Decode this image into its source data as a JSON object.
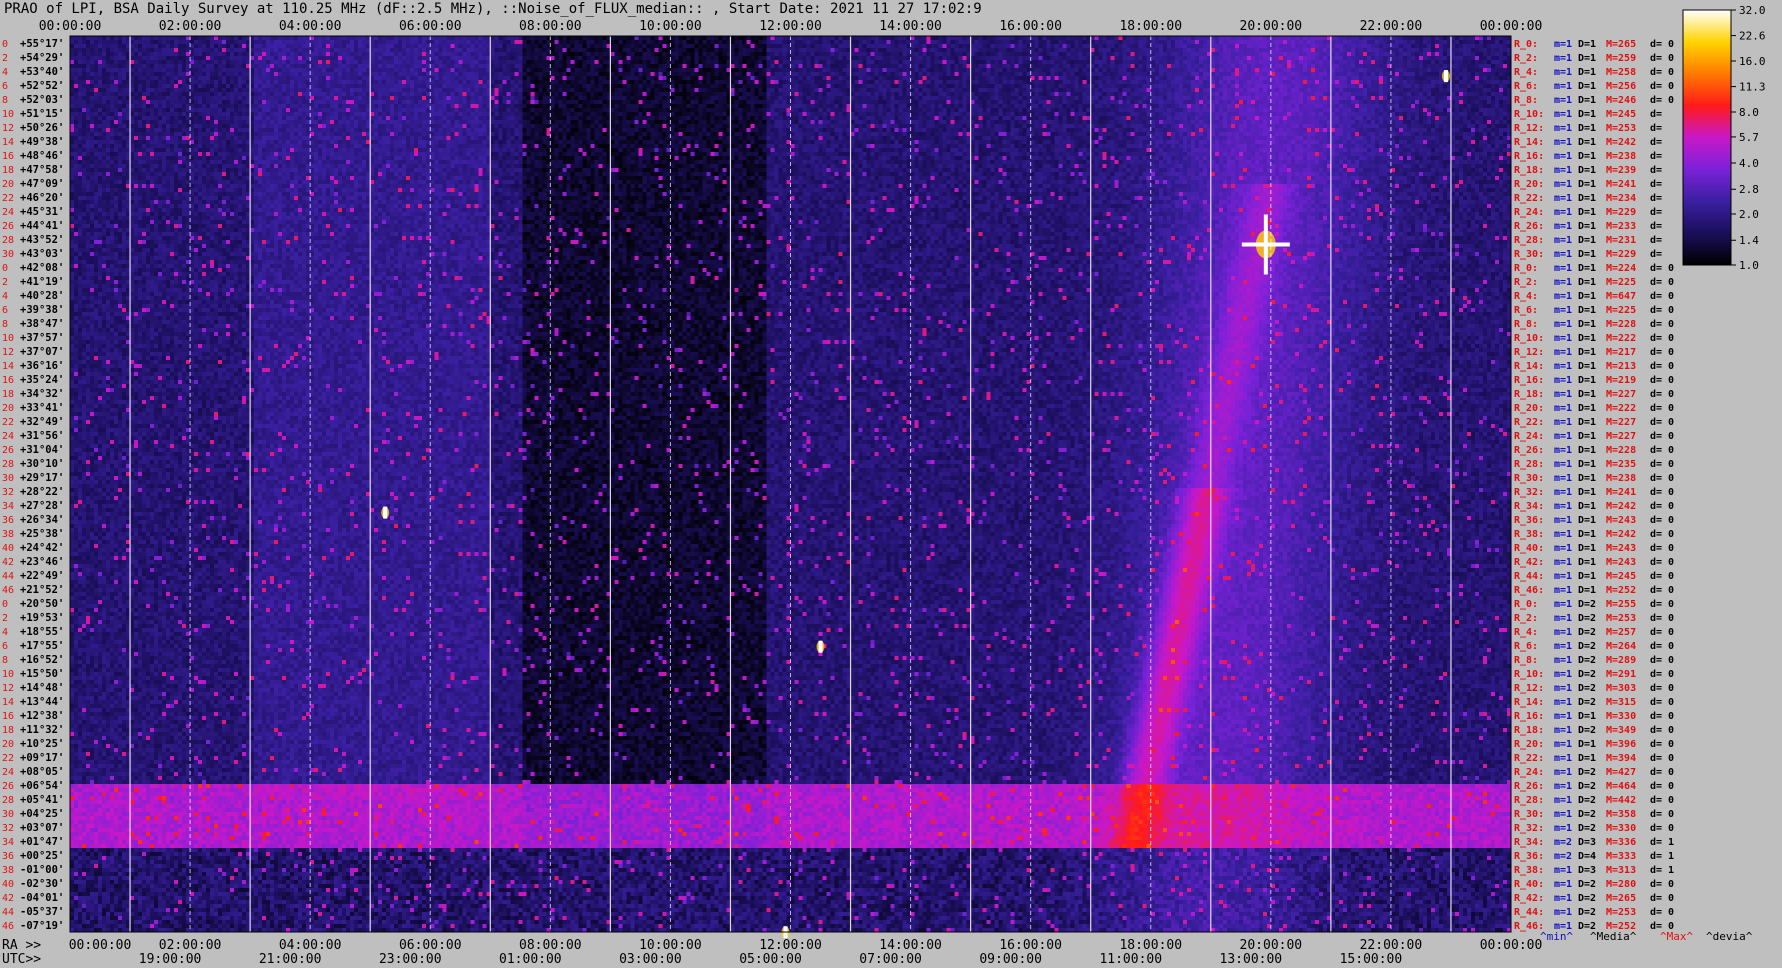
{
  "chart_data": {
    "type": "heatmap",
    "title": "PRAO of LPI, BSA Daily Survey at 110.25 MHz (dF::2.5 MHz), ::Noise_of_FLUX_median:: , Start Date: 2021 11 27 17:02:9",
    "x_top_ticks": [
      "00:00:00",
      "02:00:00",
      "04:00:00",
      "06:00:00",
      "08:00:00",
      "10:00:00",
      "12:00:00",
      "14:00:00",
      "16:00:00",
      "18:00:00",
      "20:00:00",
      "22:00:00",
      "00:00:00"
    ],
    "x_bottom_ra_ticks": [
      "00:00:00",
      "02:00:00",
      "04:00:00",
      "06:00:00",
      "08:00:00",
      "10:00:00",
      "12:00:00",
      "14:00:00",
      "16:00:00",
      "18:00:00",
      "20:00:00",
      "22:00:00",
      "00:00:00"
    ],
    "x_bottom_utc_ticks": [
      "19:00:00",
      "21:00:00",
      "23:00:00",
      "01:00:00",
      "03:00:00",
      "05:00:00",
      "07:00:00",
      "09:00:00",
      "11:00:00",
      "13:00:00",
      "15:00:00"
    ],
    "ra_label": "RA >>",
    "utc_label": "UTC>>",
    "y_ticks": [
      "+55°17'",
      "+54°29'",
      "+53°40'",
      "+52°52'",
      "+52°03'",
      "+51°15'",
      "+50°26'",
      "+49°38'",
      "+48°46'",
      "+47°58'",
      "+47°09'",
      "+46°20'",
      "+45°31'",
      "+44°41'",
      "+43°52'",
      "+43°03'",
      "+42°08'",
      "+41°19'",
      "+40°28'",
      "+39°38'",
      "+38°47'",
      "+37°57'",
      "+37°07'",
      "+36°16'",
      "+35°24'",
      "+34°32'",
      "+33°41'",
      "+32°49'",
      "+31°56'",
      "+31°04'",
      "+30°10'",
      "+29°17'",
      "+28°22'",
      "+27°28'",
      "+26°34'",
      "+25°38'",
      "+24°42'",
      "+23°46'",
      "+22°49'",
      "+21°52'",
      "+20°50'",
      "+19°53'",
      "+18°55'",
      "+17°55'",
      "+16°52'",
      "+15°50'",
      "+14°48'",
      "+13°44'",
      "+12°38'",
      "+11°32'",
      "+10°25'",
      "+09°17'",
      "+08°05'",
      "+06°54'",
      "+05°41'",
      "+04°25'",
      "+03°07'",
      "+01°47'",
      "+00°25'",
      "-01°00'",
      "-02°30'",
      "-04°01'",
      "-05°37'",
      "-07°19'"
    ],
    "row_index_labels": [
      "0",
      "2",
      "4",
      "6",
      "8",
      "10",
      "12",
      "14",
      "16",
      "18",
      "20",
      "22",
      "24",
      "26",
      "28",
      "30",
      "0",
      "2",
      "4",
      "6",
      "8",
      "10",
      "12",
      "14",
      "16",
      "18",
      "20",
      "22",
      "24",
      "26",
      "28",
      "30",
      "32",
      "34",
      "36",
      "38",
      "40",
      "42",
      "44",
      "46",
      "0",
      "2",
      "4",
      "6",
      "8",
      "10",
      "12",
      "14",
      "16",
      "18",
      "20",
      "22",
      "24",
      "26",
      "28",
      "30",
      "32",
      "34",
      "36",
      "38",
      "40",
      "42",
      "44",
      "46"
    ],
    "colorbar": {
      "ticks": [
        "32.0",
        "22.6",
        "16.0",
        "11.3",
        "8.0",
        "5.7",
        "4.0",
        "2.8",
        "2.0",
        "1.4",
        "1.0"
      ],
      "min": 1.0,
      "max": 32.0,
      "scale": "log",
      "colors": [
        "#000000",
        "#1a0f5a",
        "#3a1fa0",
        "#7a22d8",
        "#c818c8",
        "#ff1a1a",
        "#ff7a00",
        "#ffd400",
        "#ffffff"
      ]
    },
    "right_table": [
      {
        "r": "R_0:",
        "m": "m=1",
        "d": "D=1",
        "max": "M=265",
        "dev": "d= 0"
      },
      {
        "r": "R_2:",
        "m": "m=1",
        "d": "D=1",
        "max": "M=259",
        "dev": "d= 0"
      },
      {
        "r": "R_4:",
        "m": "m=1",
        "d": "D=1",
        "max": "M=258",
        "dev": "d= 0"
      },
      {
        "r": "R_6:",
        "m": "m=1",
        "d": "D=1",
        "max": "M=256",
        "dev": "d= 0"
      },
      {
        "r": "R_8:",
        "m": "m=1",
        "d": "D=1",
        "max": "M=246",
        "dev": "d= 0"
      },
      {
        "r": "R_10:",
        "m": "m=1",
        "d": "D=1",
        "max": "M=245",
        "dev": "d="
      },
      {
        "r": "R_12:",
        "m": "m=1",
        "d": "D=1",
        "max": "M=253",
        "dev": "d="
      },
      {
        "r": "R_14:",
        "m": "m=1",
        "d": "D=1",
        "max": "M=242",
        "dev": "d="
      },
      {
        "r": "R_16:",
        "m": "m=1",
        "d": "D=1",
        "max": "M=238",
        "dev": "d="
      },
      {
        "r": "R_18:",
        "m": "m=1",
        "d": "D=1",
        "max": "M=239",
        "dev": "d="
      },
      {
        "r": "R_20:",
        "m": "m=1",
        "d": "D=1",
        "max": "M=241",
        "dev": "d="
      },
      {
        "r": "R_22:",
        "m": "m=1",
        "d": "D=1",
        "max": "M=234",
        "dev": "d="
      },
      {
        "r": "R_24:",
        "m": "m=1",
        "d": "D=1",
        "max": "M=229",
        "dev": "d="
      },
      {
        "r": "R_26:",
        "m": "m=1",
        "d": "D=1",
        "max": "M=233",
        "dev": "d="
      },
      {
        "r": "R_28:",
        "m": "m=1",
        "d": "D=1",
        "max": "M=231",
        "dev": "d="
      },
      {
        "r": "R_30:",
        "m": "m=1",
        "d": "D=1",
        "max": "M=229",
        "dev": "d="
      },
      {
        "r": "R_0:",
        "m": "m=1",
        "d": "D=1",
        "max": "M=224",
        "dev": "d= 0"
      },
      {
        "r": "R_2:",
        "m": "m=1",
        "d": "D=1",
        "max": "M=225",
        "dev": "d= 0"
      },
      {
        "r": "R_4:",
        "m": "m=1",
        "d": "D=1",
        "max": "M=647",
        "dev": "d= 0"
      },
      {
        "r": "R_6:",
        "m": "m=1",
        "d": "D=1",
        "max": "M=225",
        "dev": "d= 0"
      },
      {
        "r": "R_8:",
        "m": "m=1",
        "d": "D=1",
        "max": "M=228",
        "dev": "d= 0"
      },
      {
        "r": "R_10:",
        "m": "m=1",
        "d": "D=1",
        "max": "M=222",
        "dev": "d= 0"
      },
      {
        "r": "R_12:",
        "m": "m=1",
        "d": "D=1",
        "max": "M=217",
        "dev": "d= 0"
      },
      {
        "r": "R_14:",
        "m": "m=1",
        "d": "D=1",
        "max": "M=213",
        "dev": "d= 0"
      },
      {
        "r": "R_16:",
        "m": "m=1",
        "d": "D=1",
        "max": "M=219",
        "dev": "d= 0"
      },
      {
        "r": "R_18:",
        "m": "m=1",
        "d": "D=1",
        "max": "M=227",
        "dev": "d= 0"
      },
      {
        "r": "R_20:",
        "m": "m=1",
        "d": "D=1",
        "max": "M=222",
        "dev": "d= 0"
      },
      {
        "r": "R_22:",
        "m": "m=1",
        "d": "D=1",
        "max": "M=227",
        "dev": "d= 0"
      },
      {
        "r": "R_24:",
        "m": "m=1",
        "d": "D=1",
        "max": "M=227",
        "dev": "d= 0"
      },
      {
        "r": "R_26:",
        "m": "m=1",
        "d": "D=1",
        "max": "M=228",
        "dev": "d= 0"
      },
      {
        "r": "R_28:",
        "m": "m=1",
        "d": "D=1",
        "max": "M=235",
        "dev": "d= 0"
      },
      {
        "r": "R_30:",
        "m": "m=1",
        "d": "D=1",
        "max": "M=238",
        "dev": "d= 0"
      },
      {
        "r": "R_32:",
        "m": "m=1",
        "d": "D=1",
        "max": "M=241",
        "dev": "d= 0"
      },
      {
        "r": "R_34:",
        "m": "m=1",
        "d": "D=1",
        "max": "M=242",
        "dev": "d= 0"
      },
      {
        "r": "R_36:",
        "m": "m=1",
        "d": "D=1",
        "max": "M=243",
        "dev": "d= 0"
      },
      {
        "r": "R_38:",
        "m": "m=1",
        "d": "D=1",
        "max": "M=242",
        "dev": "d= 0"
      },
      {
        "r": "R_40:",
        "m": "m=1",
        "d": "D=1",
        "max": "M=243",
        "dev": "d= 0"
      },
      {
        "r": "R_42:",
        "m": "m=1",
        "d": "D=1",
        "max": "M=243",
        "dev": "d= 0"
      },
      {
        "r": "R_44:",
        "m": "m=1",
        "d": "D=1",
        "max": "M=245",
        "dev": "d= 0"
      },
      {
        "r": "R_46:",
        "m": "m=1",
        "d": "D=1",
        "max": "M=252",
        "dev": "d= 0"
      },
      {
        "r": "R_0:",
        "m": "m=1",
        "d": "D=2",
        "max": "M=255",
        "dev": "d= 0"
      },
      {
        "r": "R_2:",
        "m": "m=1",
        "d": "D=2",
        "max": "M=253",
        "dev": "d= 0"
      },
      {
        "r": "R_4:",
        "m": "m=1",
        "d": "D=2",
        "max": "M=257",
        "dev": "d= 0"
      },
      {
        "r": "R_6:",
        "m": "m=1",
        "d": "D=2",
        "max": "M=264",
        "dev": "d= 0"
      },
      {
        "r": "R_8:",
        "m": "m=1",
        "d": "D=2",
        "max": "M=289",
        "dev": "d= 0"
      },
      {
        "r": "R_10:",
        "m": "m=1",
        "d": "D=2",
        "max": "M=291",
        "dev": "d= 0"
      },
      {
        "r": "R_12:",
        "m": "m=1",
        "d": "D=2",
        "max": "M=303",
        "dev": "d= 0"
      },
      {
        "r": "R_14:",
        "m": "m=1",
        "d": "D=2",
        "max": "M=315",
        "dev": "d= 0"
      },
      {
        "r": "R_16:",
        "m": "m=1",
        "d": "D=1",
        "max": "M=330",
        "dev": "d= 0"
      },
      {
        "r": "R_18:",
        "m": "m=1",
        "d": "D=2",
        "max": "M=349",
        "dev": "d= 0"
      },
      {
        "r": "R_20:",
        "m": "m=1",
        "d": "D=1",
        "max": "M=396",
        "dev": "d= 0"
      },
      {
        "r": "R_22:",
        "m": "m=1",
        "d": "D=1",
        "max": "M=394",
        "dev": "d= 0"
      },
      {
        "r": "R_24:",
        "m": "m=1",
        "d": "D=2",
        "max": "M=427",
        "dev": "d= 0"
      },
      {
        "r": "R_26:",
        "m": "m=1",
        "d": "D=2",
        "max": "M=464",
        "dev": "d= 0"
      },
      {
        "r": "R_28:",
        "m": "m=1",
        "d": "D=2",
        "max": "M=442",
        "dev": "d= 0"
      },
      {
        "r": "R_30:",
        "m": "m=1",
        "d": "D=2",
        "max": "M=358",
        "dev": "d= 0"
      },
      {
        "r": "R_32:",
        "m": "m=1",
        "d": "D=2",
        "max": "M=330",
        "dev": "d= 0"
      },
      {
        "r": "R_34:",
        "m": "m=2",
        "d": "D=3",
        "max": "M=336",
        "dev": "d= 1"
      },
      {
        "r": "R_36:",
        "m": "m=2",
        "d": "D=4",
        "max": "M=333",
        "dev": "d= 1"
      },
      {
        "r": "R_38:",
        "m": "m=1",
        "d": "D=3",
        "max": "M=313",
        "dev": "d= 1"
      },
      {
        "r": "R_40:",
        "m": "m=1",
        "d": "D=2",
        "max": "M=280",
        "dev": "d= 0"
      },
      {
        "r": "R_42:",
        "m": "m=1",
        "d": "D=2",
        "max": "M=265",
        "dev": "d= 0"
      },
      {
        "r": "R_44:",
        "m": "m=1",
        "d": "D=2",
        "max": "M=253",
        "dev": "d= 0"
      },
      {
        "r": "R_46:",
        "m": "m=1",
        "d": "D=2",
        "max": "M=252",
        "dev": "d= 0"
      }
    ],
    "footer_legend": [
      "^min^",
      "^Media^",
      "^Max^",
      "^devia^"
    ],
    "features": [
      {
        "kind": "band",
        "dec_from": "+03°07'",
        "dec_to": "-01°00'",
        "intensity": 5.5
      },
      {
        "kind": "bright_source",
        "ra": "19:55:00",
        "dec": "+40°44'",
        "intensity": 32.0
      },
      {
        "kind": "bright_source",
        "ra": "05:15:00",
        "dec": "+22°00'",
        "intensity": 16.0
      },
      {
        "kind": "bright_source",
        "ra": "22:55:00",
        "dec": "+52°30'",
        "intensity": 16.0
      },
      {
        "kind": "bright_source",
        "ra": "12:30:00",
        "dec": "+12°38'",
        "intensity": 16.0
      },
      {
        "kind": "bright_source",
        "ra": "11:55:00",
        "dec": "-07°19'",
        "intensity": 16.0
      },
      {
        "kind": "galactic_plane",
        "description": "",
        "intensity": 8.0
      }
    ]
  }
}
